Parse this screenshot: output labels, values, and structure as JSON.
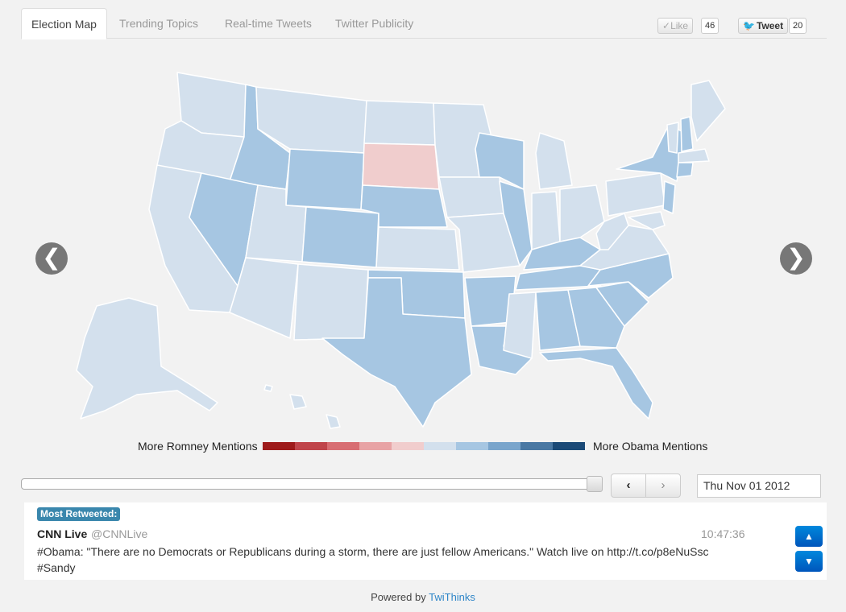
{
  "tabs": [
    {
      "label": "Election Map",
      "active": true
    },
    {
      "label": "Trending Topics",
      "active": false
    },
    {
      "label": "Real-time Tweets",
      "active": false
    },
    {
      "label": "Twitter Publicity",
      "active": false
    }
  ],
  "social": {
    "like_label": "Like",
    "like_count": "46",
    "tweet_label": "Tweet",
    "tweet_count": "20"
  },
  "map": {
    "prev_symbol": "❮",
    "next_symbol": "❯",
    "colors": {
      "romney_light": "#f0cdcd",
      "neutral": "#d3e0ed",
      "obama_light": "#a6c6e2"
    },
    "states": {
      "south_dakota": "romney_light",
      "idaho": "obama_light",
      "wyoming": "obama_light",
      "nevada": "obama_light",
      "colorado": "obama_light",
      "nebraska": "obama_light",
      "texas": "obama_light",
      "oklahoma": "obama_light",
      "arkansas": "obama_light",
      "louisiana": "obama_light",
      "wisconsin": "obama_light",
      "illinois": "obama_light",
      "kentucky": "obama_light",
      "tennessee": "obama_light",
      "alabama": "obama_light",
      "georgia": "obama_light",
      "florida": "obama_light",
      "south_carolina": "obama_light",
      "north_carolina": "obama_light",
      "new_york": "obama_light",
      "new_jersey": "obama_light",
      "new_hampshire": "obama_light",
      "connecticut": "obama_light"
    }
  },
  "legend": {
    "left_label": "More Romney Mentions",
    "right_label": "More Obama Mentions",
    "colors": [
      "#9e1b1b",
      "#c0454b",
      "#d86e73",
      "#e8a3a5",
      "#f1cdcd",
      "#d3e0ed",
      "#a6c6e2",
      "#7aa5cc",
      "#4a78a3",
      "#1b4a77"
    ]
  },
  "timeline": {
    "progress": 1.0,
    "prev_symbol": "‹",
    "next_symbol": "›",
    "date": "Thu Nov 01 2012"
  },
  "tweet": {
    "badge": "Most Retweeted:",
    "author": "CNN Live",
    "handle": "@CNNLive",
    "time": "10:47:36",
    "text_line1": "#Obama: \"There are no Democrats or Republicans during a storm, there are just fellow Americans.\" Watch live on http://t.co/p8eNuSsc",
    "text_line2": "#Sandy",
    "up_symbol": "⌃",
    "down_symbol": "⌄"
  },
  "footer": {
    "prefix": "Powered by",
    "link": "TwiThinks"
  }
}
